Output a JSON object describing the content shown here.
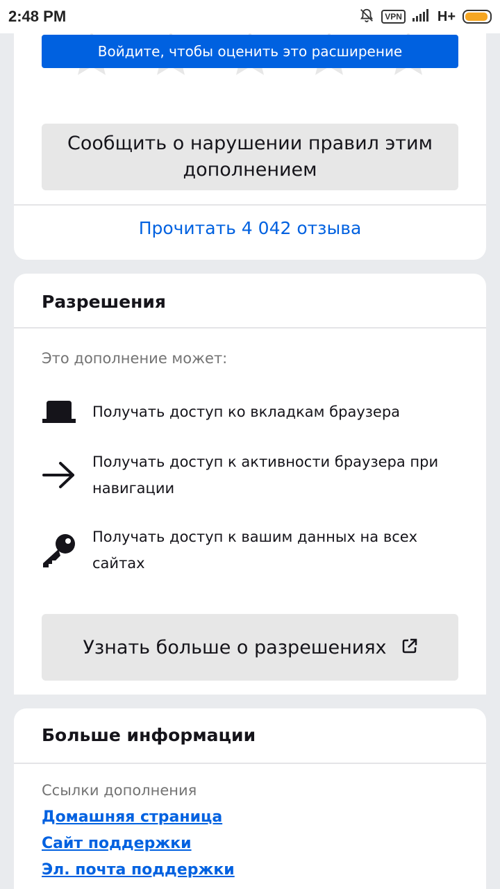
{
  "status_bar": {
    "time": "2:48 PM",
    "vpn": "VPN",
    "network": "H+",
    "battery_level": 0.95,
    "battery_color": "#f5a623"
  },
  "rating": {
    "login_prompt": "Войдите, чтобы оценить это расширение",
    "star_icon": "star-icon",
    "report_button": "Сообщить о нарушении правил этим дополнением",
    "reviews_link": "Прочитать 4 042 отзыва"
  },
  "permissions": {
    "title": "Разрешения",
    "intro": "Это дополнение может:",
    "items": [
      {
        "icon": "tab-icon",
        "text": "Получать доступ ко вкладкам браузера"
      },
      {
        "icon": "arrow-right-icon",
        "text": "Получать доступ к активности браузера при навигации"
      },
      {
        "icon": "key-icon",
        "text": "Получать доступ к вашим данных на всех сайтах"
      }
    ],
    "learn_more": "Узнать больше о разрешениях",
    "external_icon": "external-link-icon"
  },
  "more_info": {
    "title": "Больше информации",
    "links_label": "Ссылки дополнения",
    "links": [
      "Домашняя страница",
      "Сайт поддержки",
      "Эл. почта поддержки"
    ]
  },
  "colors": {
    "accent": "#0061e0",
    "background": "#e9ebee",
    "button_bg": "#e7e7e7",
    "star": "#e7e7e7"
  }
}
